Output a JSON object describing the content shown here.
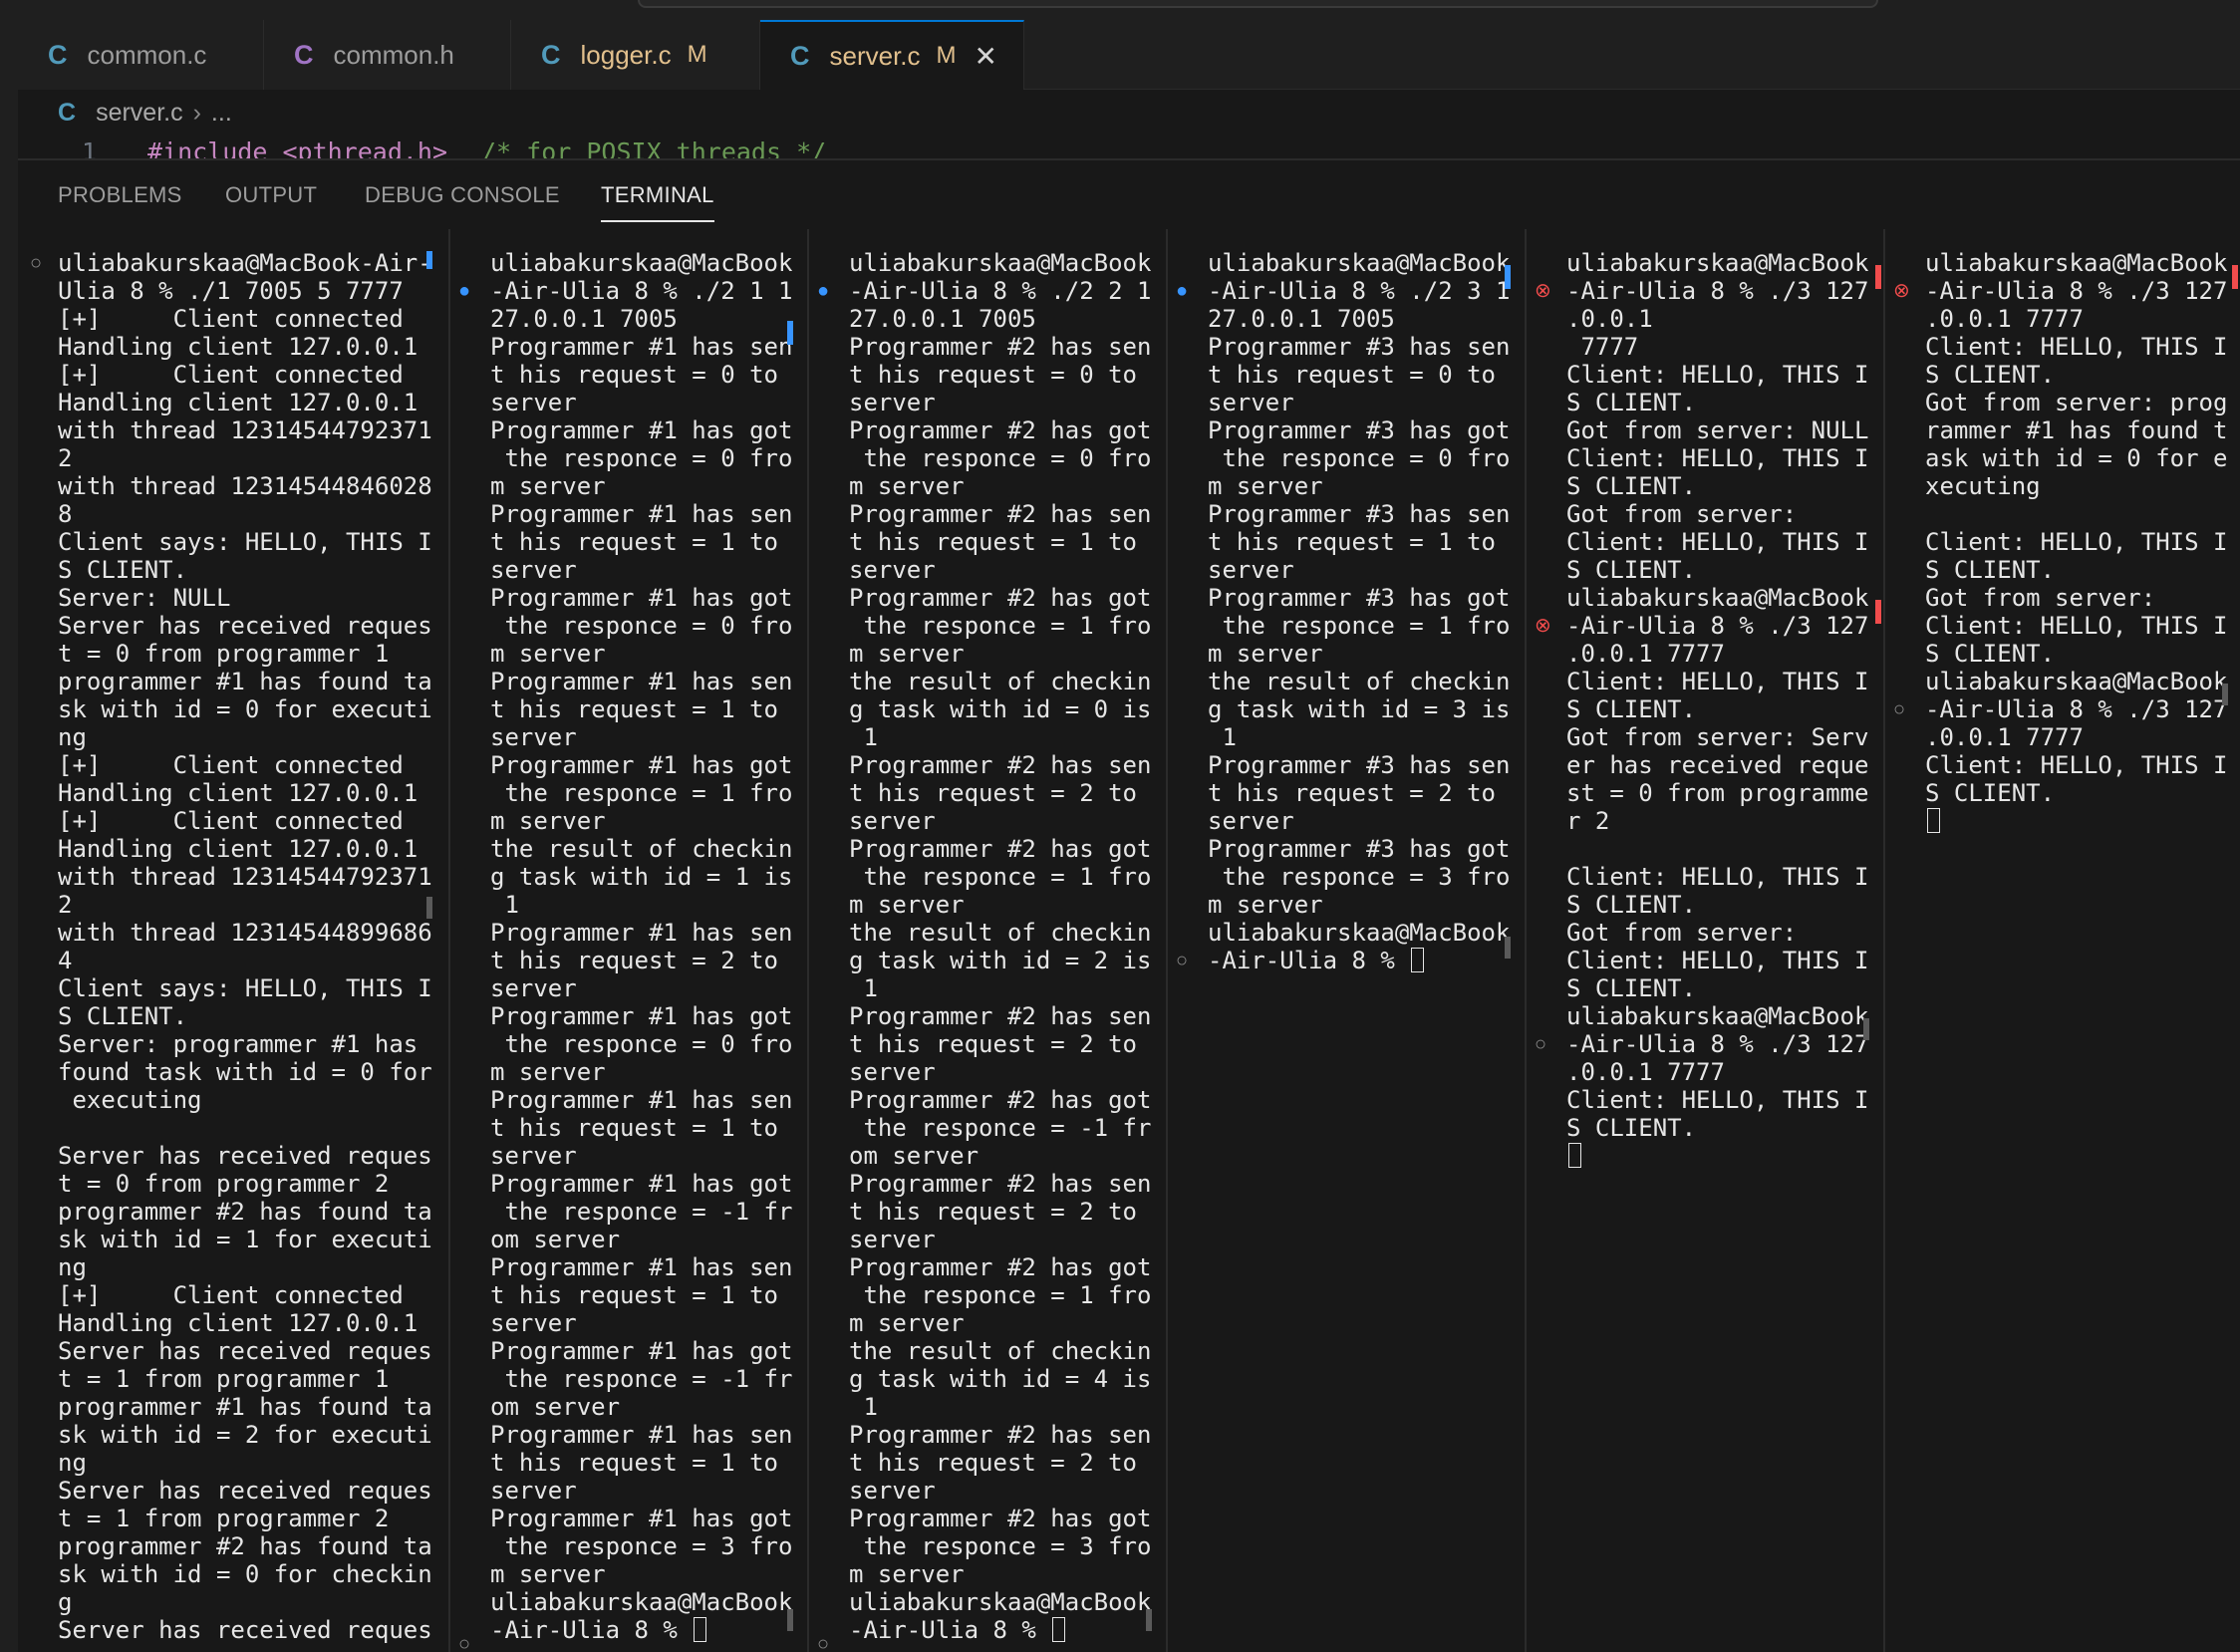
{
  "editor": {
    "tabs": [
      {
        "label": "common.c",
        "icon_letter": "C",
        "modified": false,
        "active": false
      },
      {
        "label": "common.h",
        "icon_letter": "C",
        "modified": false,
        "active": false
      },
      {
        "label": "logger.c",
        "icon_letter": "C",
        "modified": true,
        "active": false,
        "mod_flag": "M"
      },
      {
        "label": "server.c",
        "icon_letter": "C",
        "modified": true,
        "active": true,
        "mod_flag": "M",
        "close_glyph": "✕"
      }
    ],
    "breadcrumb": {
      "icon_letter": "C",
      "file": "server.c",
      "separator": "›",
      "rest": "..."
    },
    "code": {
      "line_number": "1",
      "include": "#include <pthread.h>",
      "comment": "/* for POSIX threads */"
    }
  },
  "panel": {
    "tabs": [
      "PROBLEMS",
      "OUTPUT",
      "DEBUG CONSOLE",
      "TERMINAL"
    ],
    "active_tab": "TERMINAL"
  },
  "terminals": [
    {
      "text": "uliabakurskaa@MacBook-Air-\nUlia 8 % ./1 7005 5 7777\n[+]     Client connected\nHandling client 127.0.0.1\n[+]     Client connected\nHandling client 127.0.0.1\nwith thread 12314544792371\n2\nwith thread 12314544846028\n8\nClient says: HELLO, THIS I\nS CLIENT.\nServer: NULL\nServer has received reques\nt = 0 from programmer 1\nprogrammer #1 has found ta\nsk with id = 0 for executi\nng\n[+]     Client connected\nHandling client 127.0.0.1\n[+]     Client connected\nHandling client 127.0.0.1\nwith thread 12314544792371\n2\nwith thread 12314544899686\n4\nClient says: HELLO, THIS I\nS CLIENT.\nServer: programmer #1 has\nfound task with id = 0 for\n executing\n\nServer has received reques\nt = 0 from programmer 2\nprogrammer #2 has found ta\nsk with id = 1 for executi\nng\n[+]     Client connected\nHandling client 127.0.0.1\nServer has received reques\nt = 1 from programmer 1\nprogrammer #1 has found ta\nsk with id = 2 for executi\nng\nServer has received reques\nt = 1 from programmer 2\nprogrammer #2 has found ta\nsk with id = 0 for checkin\ng\nServer has received reques",
      "cursor": false
    },
    {
      "text": "uliabakurskaa@MacBook\n-Air-Ulia 8 % ./2 1 1\n27.0.0.1 7005\nProgrammer #1 has sen\nt his request = 0 to\nserver\nProgrammer #1 has got\n the responce = 0 fro\nm server\nProgrammer #1 has sen\nt his request = 1 to\nserver\nProgrammer #1 has got\n the responce = 0 fro\nm server\nProgrammer #1 has sen\nt his request = 1 to\nserver\nProgrammer #1 has got\n the responce = 1 fro\nm server\nthe result of checkin\ng task with id = 1 is\n 1\nProgrammer #1 has sen\nt his request = 2 to\nserver\nProgrammer #1 has got\n the responce = 0 fro\nm server\nProgrammer #1 has sen\nt his request = 1 to\nserver\nProgrammer #1 has got\n the responce = -1 fr\nom server\nProgrammer #1 has sen\nt his request = 1 to\nserver\nProgrammer #1 has got\n the responce = -1 fr\nom server\nProgrammer #1 has sen\nt his request = 1 to\nserver\nProgrammer #1 has got\n the responce = 3 fro\nm server\nuliabakurskaa@MacBook\n-Air-Ulia 8 % ",
      "cursor": true
    },
    {
      "text": "uliabakurskaa@MacBook\n-Air-Ulia 8 % ./2 2 1\n27.0.0.1 7005\nProgrammer #2 has sen\nt his request = 0 to\nserver\nProgrammer #2 has got\n the responce = 0 fro\nm server\nProgrammer #2 has sen\nt his request = 1 to\nserver\nProgrammer #2 has got\n the responce = 1 fro\nm server\nthe result of checkin\ng task with id = 0 is\n 1\nProgrammer #2 has sen\nt his request = 2 to\nserver\nProgrammer #2 has got\n the responce = 1 fro\nm server\nthe result of checkin\ng task with id = 2 is\n 1\nProgrammer #2 has sen\nt his request = 2 to\nserver\nProgrammer #2 has got\n the responce = -1 fr\nom server\nProgrammer #2 has sen\nt his request = 2 to\nserver\nProgrammer #2 has got\n the responce = 1 fro\nm server\nthe result of checkin\ng task with id = 4 is\n 1\nProgrammer #2 has sen\nt his request = 2 to\nserver\nProgrammer #2 has got\n the responce = 3 fro\nm server\nuliabakurskaa@MacBook\n-Air-Ulia 8 % ",
      "cursor": true
    },
    {
      "text": "uliabakurskaa@MacBook\n-Air-Ulia 8 % ./2 3 1\n27.0.0.1 7005\nProgrammer #3 has sen\nt his request = 0 to\nserver\nProgrammer #3 has got\n the responce = 0 fro\nm server\nProgrammer #3 has sen\nt his request = 1 to\nserver\nProgrammer #3 has got\n the responce = 1 fro\nm server\nthe result of checkin\ng task with id = 3 is\n 1\nProgrammer #3 has sen\nt his request = 2 to\nserver\nProgrammer #3 has got\n the responce = 3 fro\nm server\nuliabakurskaa@MacBook\n-Air-Ulia 8 % ",
      "cursor": true
    },
    {
      "text": "uliabakurskaa@MacBook\n-Air-Ulia 8 % ./3 127\n.0.0.1\n 7777\nClient: HELLO, THIS I\nS CLIENT.\nGot from server: NULL\nClient: HELLO, THIS I\nS CLIENT.\nGot from server:\nClient: HELLO, THIS I\nS CLIENT.\nuliabakurskaa@MacBook\n-Air-Ulia 8 % ./3 127\n.0.0.1 7777\nClient: HELLO, THIS I\nS CLIENT.\nGot from server: Serv\ner has received reque\nst = 0 from programme\nr 2\n\nClient: HELLO, THIS I\nS CLIENT.\nGot from server:\nClient: HELLO, THIS I\nS CLIENT.\nuliabakurskaa@MacBook\n-Air-Ulia 8 % ./3 127\n.0.0.1 7777\nClient: HELLO, THIS I\nS CLIENT.\n",
      "cursor": true
    },
    {
      "text": "uliabakurskaa@MacBook\n-Air-Ulia 8 % ./3 127\n.0.0.1 7777\nClient: HELLO, THIS I\nS CLIENT.\nGot from server: prog\nrammer #1 has found t\nask with id = 0 for e\nxecuting\n\nClient: HELLO, THIS I\nS CLIENT.\nGot from server:\nClient: HELLO, THIS I\nS CLIENT.\nuliabakurskaa@MacBook\n-Air-Ulia 8 % ./3 127\n.0.0.1 7777\nClient: HELLO, THIS I\nS CLIENT.\n",
      "cursor": true
    }
  ]
}
